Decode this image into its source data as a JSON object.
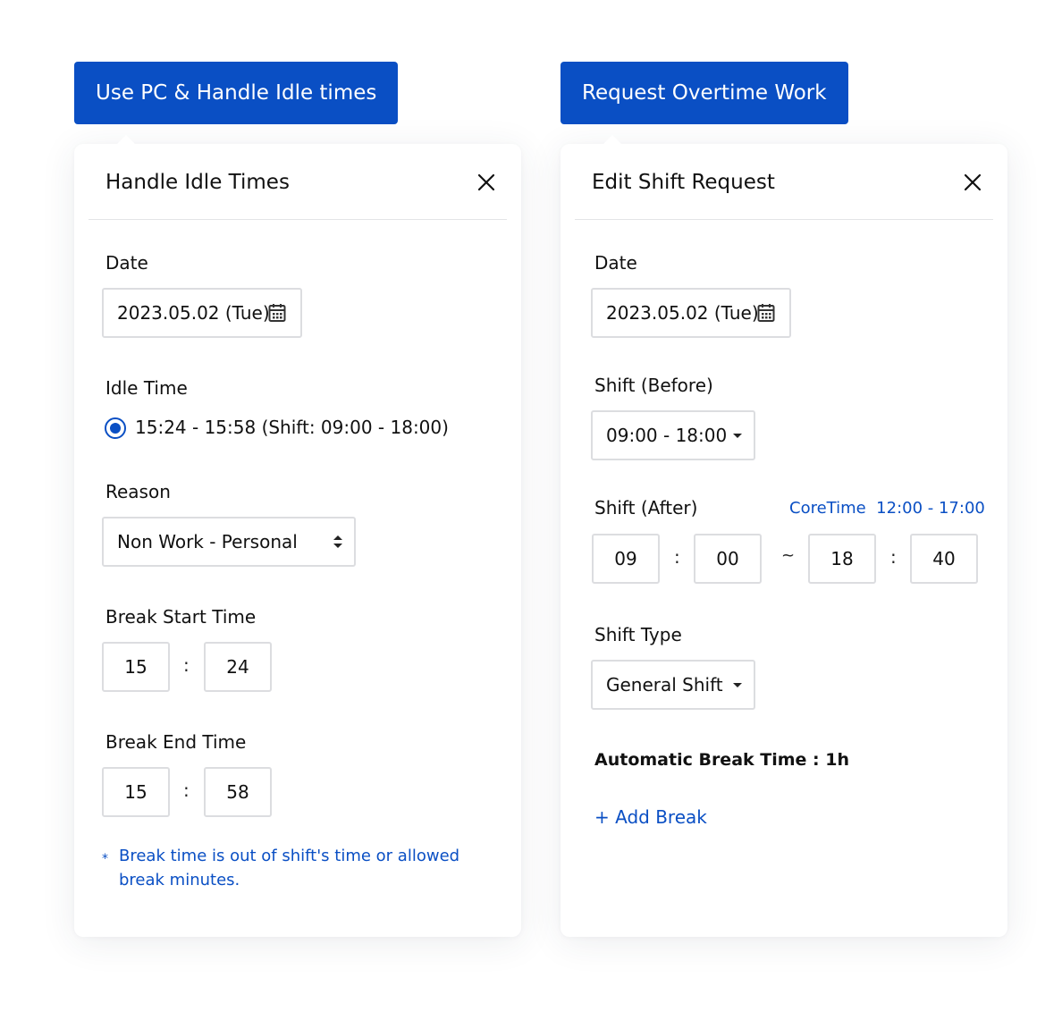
{
  "tabs": {
    "left": "Use PC & Handle Idle times",
    "right": "Request Overtime Work"
  },
  "idle_panel": {
    "title": "Handle Idle Times",
    "date_label": "Date",
    "date_value": "2023.05.02 (Tue)",
    "idle_label": "Idle Time",
    "idle_option": "15:24 - 15:58 (Shift: 09:00 - 18:00)",
    "reason_label": "Reason",
    "reason_value": "Non Work - Personal",
    "break_start_label": "Break Start Time",
    "break_start_hour": "15",
    "break_start_minute": "24",
    "break_end_label": "Break End Time",
    "break_end_hour": "15",
    "break_end_minute": "58",
    "time_separator": ":",
    "note_marker": "*",
    "note_line1": "Break time is out of shift's time or allowed",
    "note_line2": "break minutes."
  },
  "shift_panel": {
    "title": "Edit Shift Request",
    "date_label": "Date",
    "date_value": "2023.05.02 (Tue)",
    "before_label": "Shift (Before)",
    "before_value": "09:00 - 18:00",
    "after_label": "Shift (After)",
    "coretime_label": "CoreTime",
    "coretime_value": "12:00 - 17:00",
    "after_start_hour": "09",
    "after_start_minute": "00",
    "after_end_hour": "18",
    "after_end_minute": "40",
    "time_separator": ":",
    "range_separator": "~",
    "type_label": "Shift Type",
    "type_value": "General Shift",
    "auto_break": "Automatic Break Time : 1h",
    "add_break": "+ Add Break"
  },
  "icons": {
    "close": "close-icon",
    "calendar": "calendar-icon",
    "dropdown": "chevron-down-icon",
    "sort": "sort-arrows-icon"
  },
  "colors": {
    "accent": "#0a4fc4",
    "border": "#dcdde0"
  }
}
